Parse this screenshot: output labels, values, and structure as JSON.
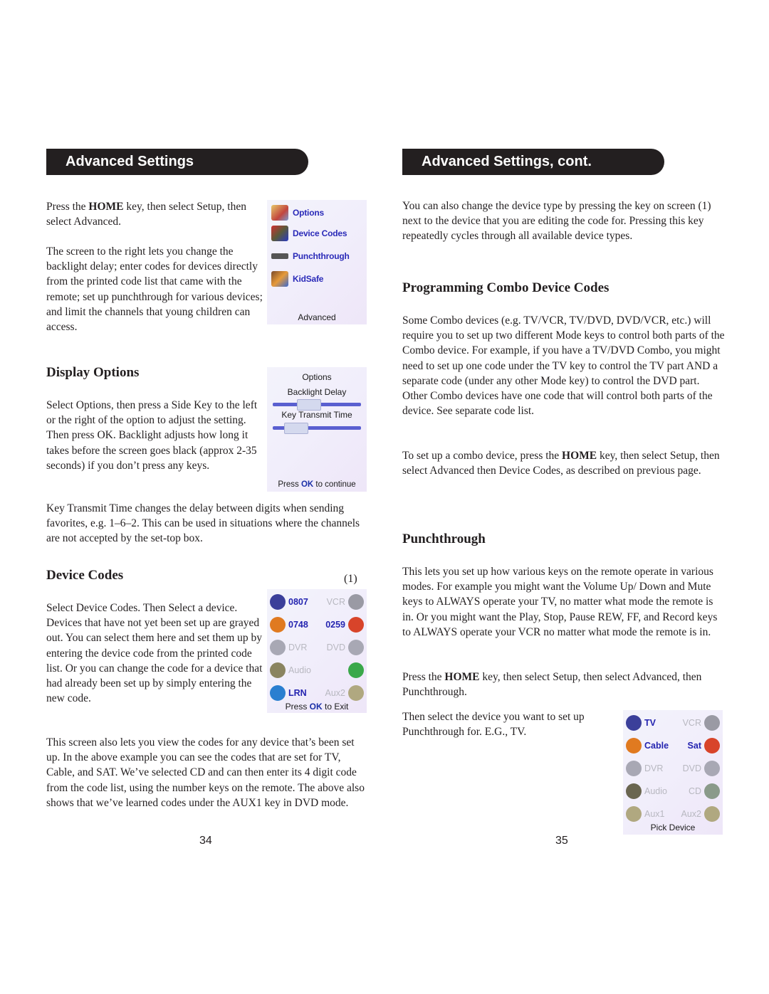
{
  "left_page": {
    "header": "Advanced Settings",
    "intro_1": {
      "pre": "Press the ",
      "bold": "HOME",
      "post": " key, then select Setup, then select Advanced."
    },
    "intro_2": "The screen to the right lets you change the backlight delay; enter codes for devices directly from the printed code list that came with the remote; set up punchthrough for various devices; and limit the channels that young children can access.",
    "advanced_screen": {
      "items": [
        {
          "label": "Options",
          "icon": "options-icon",
          "color": "#d9b24a"
        },
        {
          "label": "Device Codes",
          "icon": "device-codes-icon",
          "color": "#c0353a"
        },
        {
          "label": "Punchthrough",
          "icon": "punchthrough-icon",
          "color": "#6b6b6b"
        },
        {
          "label": "KidSafe",
          "icon": "kidsafe-icon",
          "color": "#e08a2a"
        }
      ],
      "footer": "Advanced"
    },
    "display_options": {
      "heading": "Display Options",
      "body": "Select Options, then press a Side Key to the left or the right of the option to adjust the setting. Then press OK. Backlight adjusts how long it takes before the screen goes black (approx 2-35 seconds) if you don’t press any keys.",
      "screen": {
        "title": "Options",
        "sliders": [
          {
            "label": "Backlight Delay",
            "value_fraction": 0.37
          },
          {
            "label": "Key Transmit Time",
            "value_fraction": 0.17
          }
        ],
        "footer_pre": "Press ",
        "footer_ok": "OK",
        "footer_post": " to continue"
      }
    },
    "key_transmit": "Key Transmit Time changes the delay between digits when sending favorites, e.g. 1–6–2. This can be used in situations where the channels are not accepted by the set-top box.",
    "device_codes": {
      "heading": "Device Codes",
      "callout": "(1)",
      "body": "Select Device Codes. Then Select a device. Devices that have not yet been set up are grayed out. You can select them here and set them up by entering the device code from the printed code list. Or you can change the code for a device that had already been set up by simply entering the new code.",
      "screen": {
        "rows": [
          {
            "left": {
              "text": "0807",
              "active": true,
              "icon": "tv-icon",
              "color": "#3b3f9a"
            },
            "right": {
              "text": "VCR",
              "active": false,
              "icon": "vcr-icon",
              "color": "#9a9aa4"
            }
          },
          {
            "left": {
              "text": "0748",
              "active": true,
              "icon": "cable-box-icon",
              "color": "#e07a20"
            },
            "right": {
              "text": "0259",
              "active": true,
              "icon": "satellite-dish-icon",
              "color": "#d8442a"
            }
          },
          {
            "left": {
              "text": "DVR",
              "active": false,
              "icon": "dvr-icon",
              "color": "#a8a8b4"
            },
            "right": {
              "text": "DVD",
              "active": false,
              "icon": "dvd-icon",
              "color": "#a8a8b4"
            }
          },
          {
            "left": {
              "text": "Audio",
              "active": false,
              "icon": "audio-icon",
              "color": "#8a8460"
            },
            "right": {
              "text": "",
              "active": true,
              "icon": "cd-icon",
              "color": "#3aa84a"
            }
          },
          {
            "left": {
              "text": "LRN",
              "active": true,
              "icon": "learn-icon",
              "color": "#2a7fd0"
            },
            "right": {
              "text": "Aux2",
              "active": false,
              "icon": "help-question-icon",
              "color": "#b0a880"
            }
          }
        ],
        "footer_pre": "Press ",
        "footer_ok": "OK",
        "footer_post": " to Exit"
      }
    },
    "view_codes": "This screen also lets you view the codes for any device that’s been set up. In the above example you can see the codes that are set for TV, Cable, and SAT. We’ve selected CD and can then enter its 4 digit code from the code list, using the number keys on the remote. The above also shows that we’ve learned codes under the AUX1 key in DVD mode.",
    "page_number": "34"
  },
  "right_page": {
    "header": "Advanced Settings, cont.",
    "device_type": "You can also change the device type by pressing the key on screen (1) next to the device that you are editing the code for. Pressing this key repeatedly cycles through all available device types.",
    "combo": {
      "heading": "Programming Combo Device Codes",
      "body": "Some Combo devices (e.g. TV/VCR, TV/DVD, DVD/VCR, etc.) will require you to set up two different Mode keys to control both parts of the Combo device. For example, if you have a TV/DVD Combo, you might need to set up one code under the TV key to control the TV part AND a separate code (under any other Mode key) to control the DVD part. Other Combo devices have one code that will control both parts of the device. See separate code list.",
      "setup": {
        "pre": "To set up a combo device, press the ",
        "bold": "HOME",
        "post": " key, then select Setup, then select Advanced then Device Codes, as described on previous page."
      }
    },
    "punchthrough": {
      "heading": "Punchthrough",
      "body": "This lets you set up how various keys on the remote operate in various modes. For example you might want the Volume Up/ Down and Mute keys to ALWAYS operate your TV, no matter what mode the remote is in. Or you might want the Play, Stop, Pause REW, FF, and Record keys to ALWAYS operate your VCR no matter what mode the remote is in.",
      "home": {
        "pre": "Press the ",
        "bold": "HOME",
        "post": " key, then select Setup, then select Advanced, then Punchthrough."
      },
      "select": "Then select the device you want to set up Punchthrough for. E.G., TV.",
      "screen": {
        "rows": [
          {
            "left": {
              "text": "TV",
              "active": true,
              "icon": "tv-icon",
              "color": "#3b3f9a"
            },
            "right": {
              "text": "VCR",
              "active": false,
              "icon": "vcr-icon",
              "color": "#9a9aa4"
            }
          },
          {
            "left": {
              "text": "Cable",
              "active": true,
              "icon": "cable-box-icon",
              "color": "#e07a20"
            },
            "right": {
              "text": "Sat",
              "active": true,
              "icon": "satellite-dish-icon",
              "color": "#d8442a"
            }
          },
          {
            "left": {
              "text": "DVR",
              "active": false,
              "icon": "dvr-icon",
              "color": "#a8a8b4"
            },
            "right": {
              "text": "DVD",
              "active": false,
              "icon": "dvd-icon",
              "color": "#a8a8b4"
            }
          },
          {
            "left": {
              "text": "Audio",
              "active": false,
              "icon": "audio-icon",
              "color": "#6a6650"
            },
            "right": {
              "text": "CD",
              "active": false,
              "icon": "cd-icon",
              "color": "#8a9a8a"
            }
          },
          {
            "left": {
              "text": "Aux1",
              "active": false,
              "icon": "help-question-icon",
              "color": "#b0a880"
            },
            "right": {
              "text": "Aux2",
              "active": false,
              "icon": "help-question-icon",
              "color": "#b0a880"
            }
          }
        ],
        "footer": "Pick Device"
      }
    },
    "page_number": "35"
  }
}
